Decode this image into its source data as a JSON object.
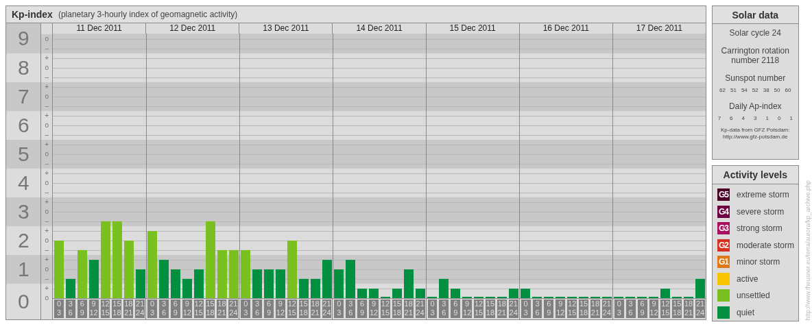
{
  "kp_panel": {
    "title": "Kp-index",
    "subtitle": "(planetary 3-hourly index of geomagnetic activity)",
    "scale": [
      {
        "marks": [
          "o",
          "–"
        ]
      },
      {
        "marks": [
          "+",
          "o",
          "–"
        ]
      },
      {
        "marks": [
          "+",
          "o",
          "–"
        ]
      },
      {
        "marks": [
          "+",
          "o",
          "–"
        ]
      },
      {
        "marks": [
          "+",
          "o",
          "–"
        ]
      },
      {
        "marks": [
          "+",
          "o",
          "–"
        ]
      },
      {
        "marks": [
          "+",
          "o",
          "–"
        ]
      },
      {
        "marks": [
          "+",
          "o",
          "–"
        ]
      },
      {
        "marks": [
          "+",
          "o",
          "–"
        ]
      },
      {
        "marks": [
          "+",
          "o"
        ]
      }
    ],
    "days": [
      "11 Dec 2011",
      "12 Dec 2011",
      "13 Dec 2011",
      "14 Dec 2011",
      "15 Dec 2011",
      "16 Dec 2011",
      "17 Dec 2011"
    ],
    "chart_data": {
      "type": "bar",
      "ylim": [
        0,
        9
      ],
      "yticks": [
        0,
        1,
        2,
        3,
        4,
        5,
        6,
        7,
        8,
        9
      ],
      "grid": true,
      "categories": [
        "0\n3",
        "3\n6",
        "6\n9",
        "9\n12",
        "12\n15",
        "15\n18",
        "18\n21",
        "21\n24",
        "0\n3",
        "3\n6",
        "6\n9",
        "9\n12",
        "12\n15",
        "15\n18",
        "18\n21",
        "21\n24",
        "0\n3",
        "3\n6",
        "6\n9",
        "9\n12",
        "12\n15",
        "15\n18",
        "18\n21",
        "21\n24",
        "0\n3",
        "3\n6",
        "6\n9",
        "9\n12",
        "12\n15",
        "15\n18",
        "18\n21",
        "21\n24",
        "0\n3",
        "3\n6",
        "6\n9",
        "9\n12",
        "12\n15",
        "15\n18",
        "18\n21",
        "21\n24",
        "0\n3",
        "3\n6",
        "6\n9",
        "9\n12",
        "12\n15",
        "15\n18",
        "18\n21",
        "21\n24",
        "0\n3",
        "3\n6",
        "6\n9",
        "9\n12",
        "12\n15",
        "15\n18",
        "18\n21",
        "21\n24"
      ],
      "series": [
        {
          "color": "#7ac020",
          "values": [
            2,
            null,
            1.67,
            null,
            2.67,
            2.67,
            2,
            null,
            2.33,
            null,
            null,
            null,
            null,
            2.67,
            1.67,
            1.67,
            1.67,
            null,
            null,
            null,
            2,
            null,
            null,
            null,
            null,
            null,
            null,
            null,
            null,
            null,
            null,
            null,
            null,
            null,
            null,
            null,
            null,
            null,
            null,
            null,
            null,
            null,
            null,
            null,
            null,
            null,
            null,
            null,
            null,
            null,
            null,
            null,
            null,
            null,
            null,
            null
          ]
        },
        {
          "color": "#009040",
          "values": [
            null,
            0.67,
            null,
            1.33,
            null,
            null,
            null,
            1,
            null,
            1.33,
            1,
            0.67,
            1,
            null,
            null,
            null,
            null,
            1,
            1,
            1,
            null,
            0.67,
            0.67,
            1.33,
            1,
            1.33,
            0.33,
            0.33,
            0,
            0.33,
            1,
            0.33,
            0,
            0.67,
            0.33,
            0,
            0,
            0,
            0,
            0.33,
            0.33,
            0,
            0,
            0,
            0,
            0,
            0,
            0,
            0,
            0,
            0,
            0,
            0.33,
            0,
            0,
            0.67
          ]
        }
      ]
    }
  },
  "solar_data": {
    "title": "Solar data",
    "cycle": "Solar cycle 24",
    "rotation": "Carrington rotation number 2118",
    "sunspot_label": "Sunspot number",
    "sunspot_numbers": [
      "62",
      "51",
      "54",
      "52",
      "38",
      "50",
      "60"
    ],
    "ap_label": "Daily Ap-index",
    "ap_values": [
      "7",
      "6",
      "4",
      "3",
      "1",
      "0",
      "1"
    ],
    "source_note": "Kp-data from GFZ Potsdam:",
    "source_link": "http://www.gfz-potsdam.de"
  },
  "activity_levels": {
    "title": "Activity levels",
    "items": [
      {
        "kind": "storm",
        "badge": "G5",
        "label": "extreme storm",
        "color": "#4c0028"
      },
      {
        "kind": "storm",
        "badge": "G4",
        "label": "severe storm",
        "color": "#6c0040"
      },
      {
        "kind": "storm",
        "badge": "G3",
        "label": "strong storm",
        "color": "#a8105c"
      },
      {
        "kind": "storm",
        "badge": "G2",
        "label": "moderate storm",
        "color": "#d83020"
      },
      {
        "kind": "storm",
        "badge": "G1",
        "label": "minor storm",
        "color": "#e07818"
      },
      {
        "kind": "plain",
        "label": "active",
        "color": "#f8c400"
      },
      {
        "kind": "plain",
        "label": "unsettled",
        "color": "#7ac020"
      },
      {
        "kind": "plain",
        "label": "quiet",
        "color": "#009040"
      }
    ]
  },
  "page_url": "http://www.theusner.eu/terra/aurora/kp_archive.php"
}
